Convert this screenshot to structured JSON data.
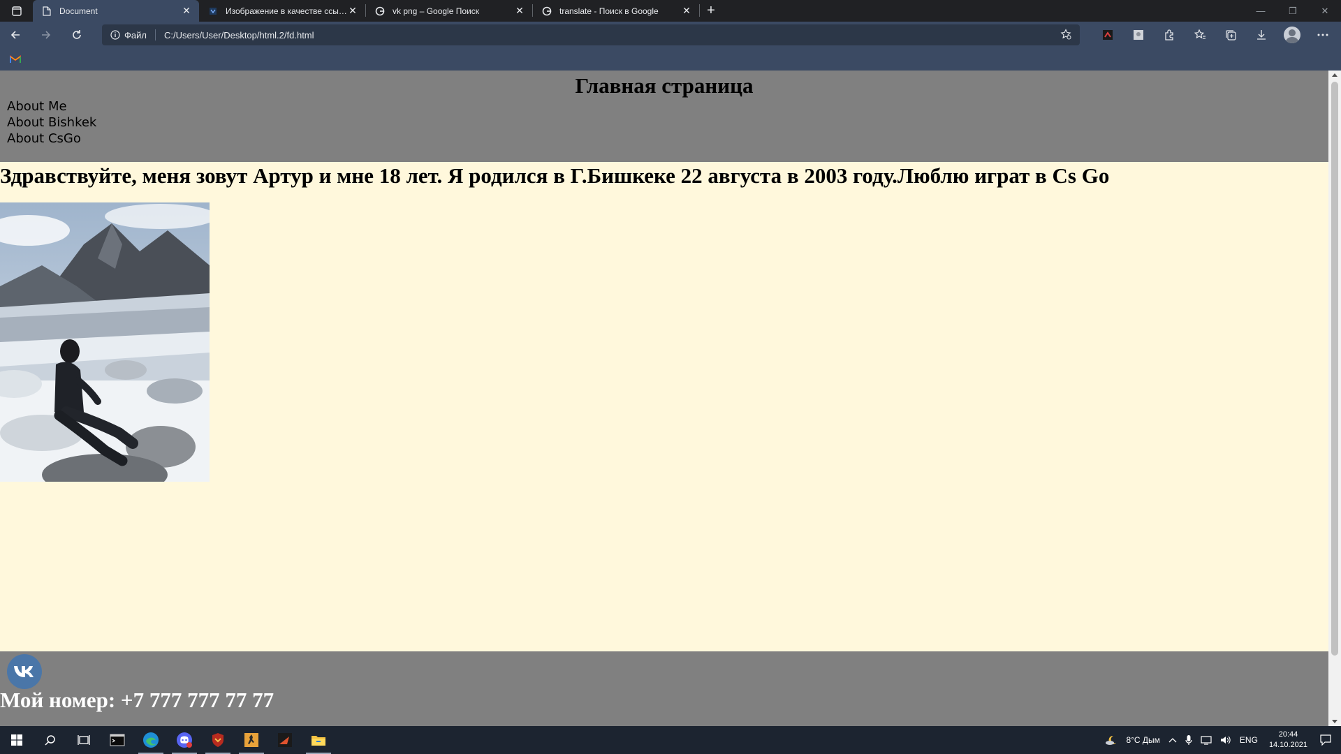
{
  "browser": {
    "tabs": [
      {
        "title": "Document",
        "active": true
      },
      {
        "title": "Изображение в качестве ссылки",
        "active": false
      },
      {
        "title": "vk png – Google Поиск",
        "active": false
      },
      {
        "title": "translate - Поиск в Google",
        "active": false
      }
    ],
    "address": {
      "scheme_label": "Файл",
      "url": "C:/Users/User/Desktop/html.2/fd.html"
    }
  },
  "page": {
    "background": "#fff8dc",
    "header": {
      "title": "Главная страница",
      "nav": [
        "About Me",
        "About Bishkek",
        "About CsGo"
      ],
      "background": "#808080"
    },
    "intro": "Здравствуйте, меня зовут Артур и мне 18 лет. Я родился в Г.Бишкеке 22 августа в 2003 году.Люблю играт в Cs Go",
    "footer": {
      "phone": "Мой номер: +7 777 777 77 77",
      "social_icon": "vk-icon",
      "background": "#808080"
    }
  },
  "taskbar": {
    "apps": [
      "start",
      "search",
      "task-view",
      "terminal",
      "edge",
      "discord",
      "shield-app",
      "csgo",
      "game-app",
      "file-explorer"
    ],
    "weather": "8°C Дым",
    "language": "ENG",
    "time": "20:44",
    "date": "14.10.2021"
  }
}
